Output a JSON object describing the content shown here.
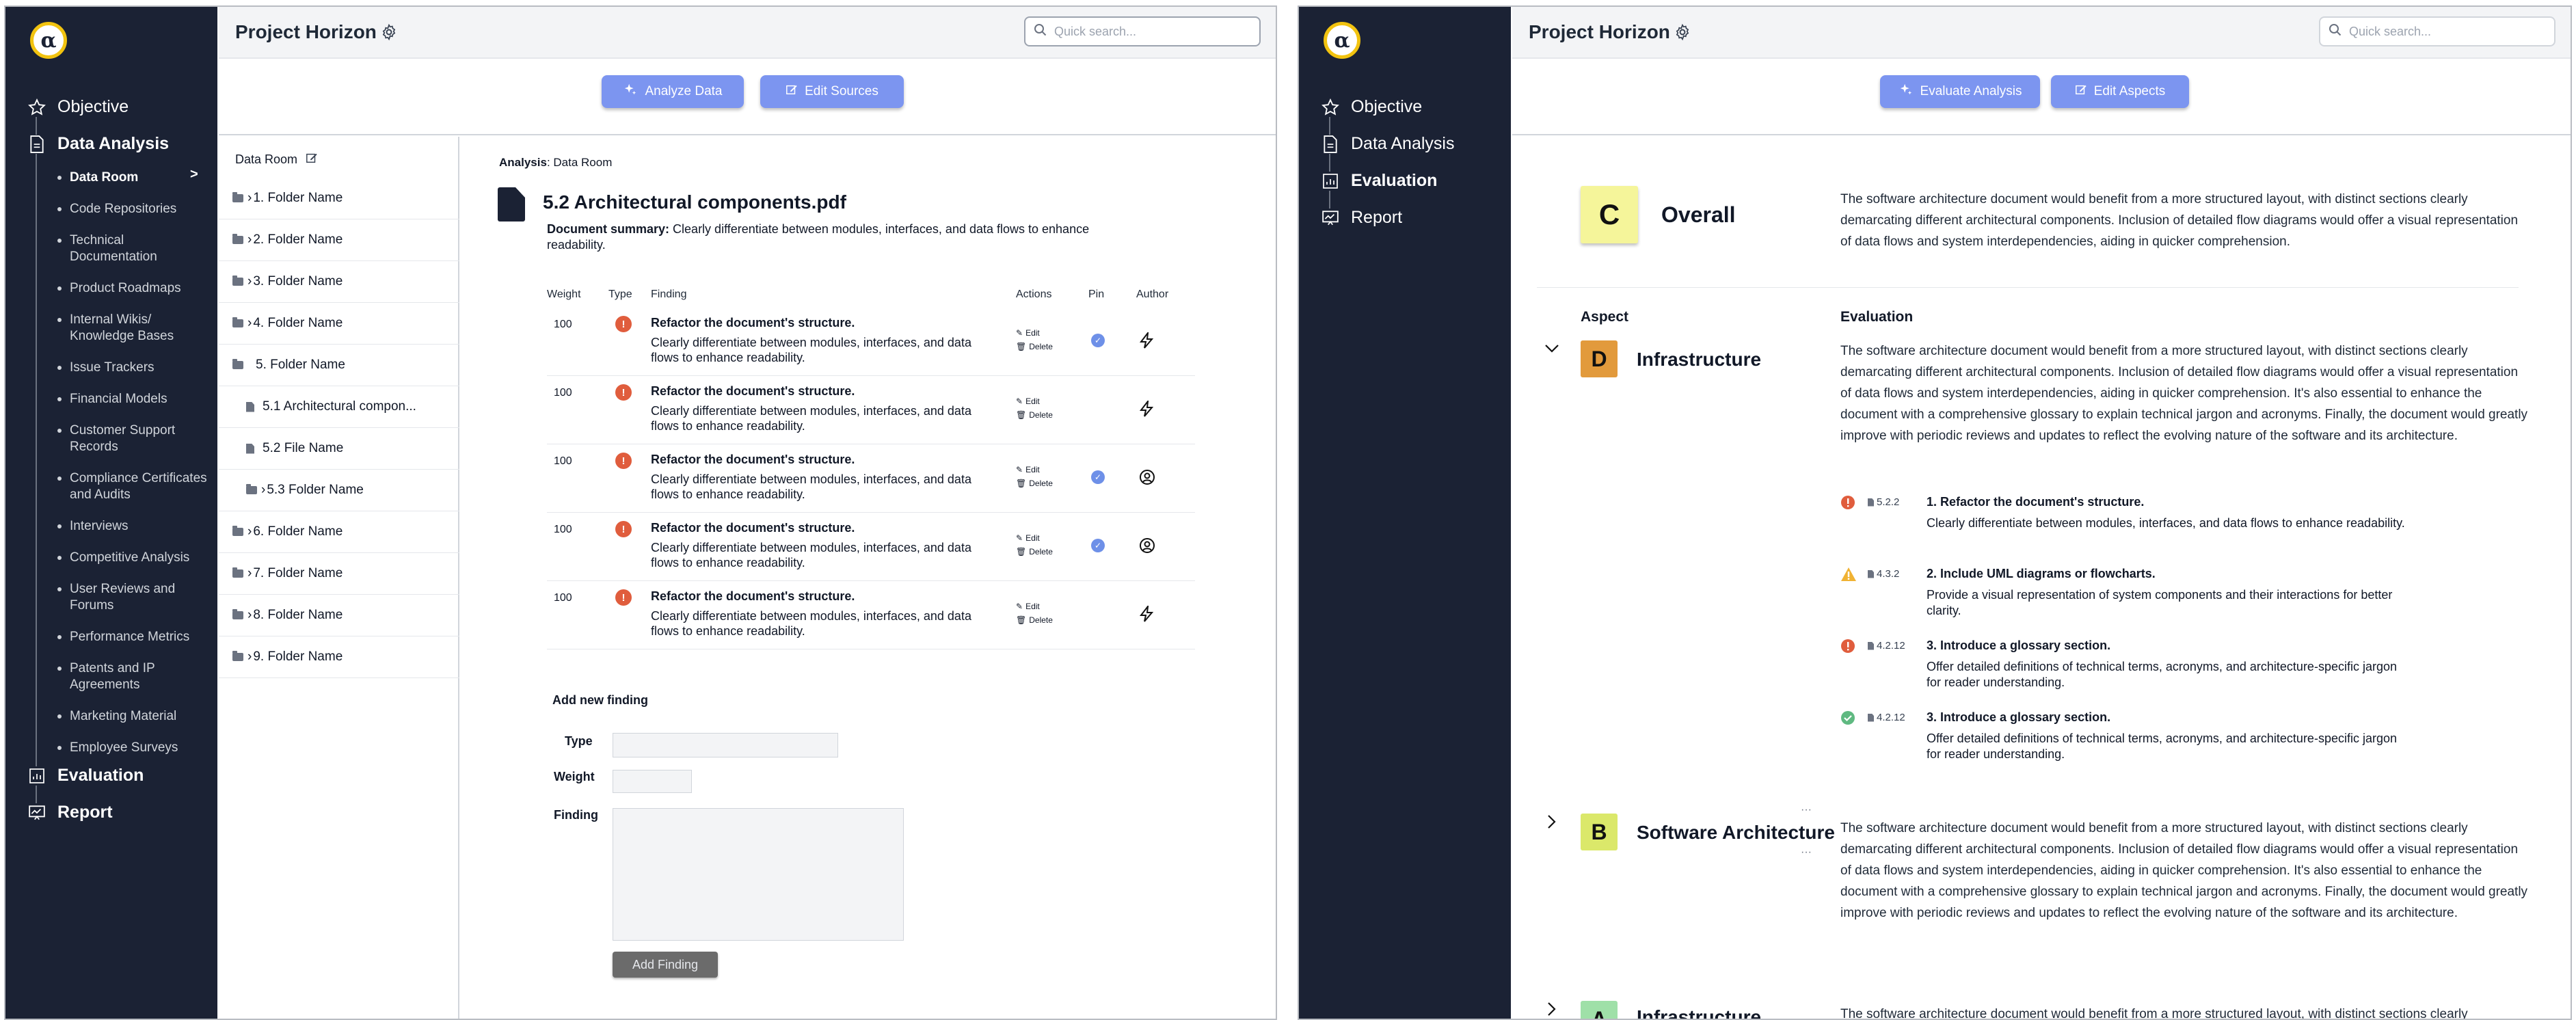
{
  "app": {
    "logo_glyph": "α",
    "project_title": "Project Horizon",
    "search_placeholder": "Quick search..."
  },
  "colors": {
    "sidebar_bg": "#1b2234",
    "accent": "#7c95f0",
    "logo_ring": "#f2c30f",
    "error": "#e05d3d",
    "warning": "#f0b233",
    "success": "#5fb981",
    "pin": "#6e90e8"
  },
  "left_screen": {
    "nav": {
      "objective": "Objective",
      "data_analysis": "Data Analysis",
      "sub_items": [
        "Data Room",
        "Code Repositories",
        "Technical Documentation",
        "Product Roadmaps",
        "Internal Wikis/ Knowledge Bases",
        "Issue Trackers",
        "Financial Models",
        "Customer Support Records",
        "Compliance Certificates and Audits",
        "Interviews",
        "Competitive Analysis",
        "User Reviews and Forums",
        "Performance Metrics",
        "Patents and IP Agreements",
        "Marketing Material",
        "Employee Surveys"
      ],
      "active_marker": ">",
      "evaluation": "Evaluation",
      "report": "Report"
    },
    "buttons": {
      "analyze": "Analyze Data",
      "edit_sources": "Edit Sources"
    },
    "tree": {
      "title": "Data Room",
      "rows": [
        "1. Folder Name",
        "2. Folder Name",
        "3. Folder Name",
        "4. Folder Name",
        "5. Folder Name",
        "5.1 Architectural compon...",
        "5.2 File Name",
        "5.3 Folder Name",
        "6. Folder Name",
        "7. Folder Name",
        "8. Folder Name",
        "9. Folder Name"
      ]
    },
    "analysis": {
      "label": "Analysis",
      "location": ": Data Room",
      "doc_title": "5.2 Architectural components.pdf",
      "summary_label": "Document summary:",
      "summary_text": " Clearly differentiate between modules, interfaces, and data flows to enhance readability.",
      "headers": {
        "weight": "Weight",
        "type": "Type",
        "finding": "Finding",
        "actions": "Actions",
        "pin": "Pin",
        "author": "Author"
      },
      "action_edit": "Edit",
      "action_delete": "Delete",
      "type_icon_glyph": "!",
      "findings": [
        {
          "weight": "100",
          "title": "Refactor the document's structure.",
          "desc": "Clearly differentiate between modules, interfaces, and data flows to enhance readability.",
          "pinned": true,
          "author": "bolt-icon"
        },
        {
          "weight": "100",
          "title": "Refactor the document's structure.",
          "desc": "Clearly differentiate between modules, interfaces, and data flows to enhance readability.",
          "pinned": false,
          "author": "bolt-icon"
        },
        {
          "weight": "100",
          "title": "Refactor the document's structure.",
          "desc": "Clearly differentiate between modules, interfaces, and data flows to enhance readability.",
          "pinned": true,
          "author": "user-circle-icon"
        },
        {
          "weight": "100",
          "title": "Refactor the document's structure.",
          "desc": "Clearly differentiate between modules, interfaces, and data flows to enhance readability.",
          "pinned": true,
          "author": "user-circle-icon"
        },
        {
          "weight": "100",
          "title": "Refactor the document's structure.",
          "desc": "Clearly differentiate between modules, interfaces, and data flows to enhance readability.",
          "pinned": false,
          "author": "bolt-icon"
        }
      ],
      "form": {
        "heading": "Add new finding",
        "type_label": "Type",
        "weight_label": "Weight",
        "finding_label": "Finding",
        "submit": "Add Finding"
      }
    }
  },
  "right_screen": {
    "nav": {
      "objective": "Objective",
      "data_analysis": "Data Analysis",
      "evaluation": "Evaluation",
      "report": "Report"
    },
    "buttons": {
      "evaluate": "Evaluate Analysis",
      "edit_aspects": "Edit Aspects"
    },
    "overall": {
      "grade": "C",
      "label": "Overall",
      "text": "The software architecture document would benefit from a more structured layout, with distinct sections clearly demarcating different architectural components. Inclusion of detailed flow diagrams would offer a visual representation of data flows and system interdependencies, aiding in quicker comprehension."
    },
    "col_aspect": "Aspect",
    "col_evaluation": "Evaluation",
    "aspects": [
      {
        "grade": "D",
        "name": "Infrastructure",
        "color": "#e29a3c",
        "text": "The software architecture document would benefit from a more structured layout, with distinct sections clearly demarcating different architectural components. Inclusion of detailed flow diagrams would offer a visual representation of data flows and system interdependencies, aiding in quicker comprehension. It's also essential to enhance the document with a comprehensive glossary to explain technical jargon and acronyms. Finally, the document would greatly improve with periodic reviews and updates to reflect the evolving nature of the software and its architecture."
      },
      {
        "grade": "B",
        "name": "Software Architecture",
        "color": "#dbe86a",
        "text": "The software architecture document would benefit from a more structured layout, with distinct sections clearly demarcating different architectural components. Inclusion of detailed flow diagrams would offer a visual representation of data flows and system interdependencies, aiding in quicker comprehension. It's also essential to enhance the document with a comprehensive glossary to explain technical jargon and acronyms. Finally, the document would greatly improve with periodic reviews and updates to reflect the evolving nature of the software and its architecture."
      },
      {
        "grade": "A",
        "name": "Infrastructure",
        "color": "#9fe0a8",
        "text": "The software architecture document would benefit from a more structured layout, with distinct sections clearly"
      }
    ],
    "sub_findings": [
      {
        "status": "error",
        "ref": "5.2.2",
        "title": "1. Refactor the document's structure.",
        "desc": "Clearly differentiate between modules, interfaces, and data flows to enhance readability."
      },
      {
        "status": "warning",
        "ref": "4.3.2",
        "title": "2. Include UML diagrams or flowcharts.",
        "desc": "Provide a visual representation of system components and their interactions for better clarity."
      },
      {
        "status": "error",
        "ref": "4.2.12",
        "title": "3. Introduce a glossary section.",
        "desc": "Offer detailed definitions of technical terms, acronyms, and architecture-specific jargon for reader understanding."
      },
      {
        "status": "success",
        "ref": "4.2.12",
        "title": "3. Introduce a glossary section.",
        "desc": "Offer detailed definitions of technical terms, acronyms, and architecture-specific jargon for reader understanding."
      }
    ],
    "ellipsis": "···"
  }
}
